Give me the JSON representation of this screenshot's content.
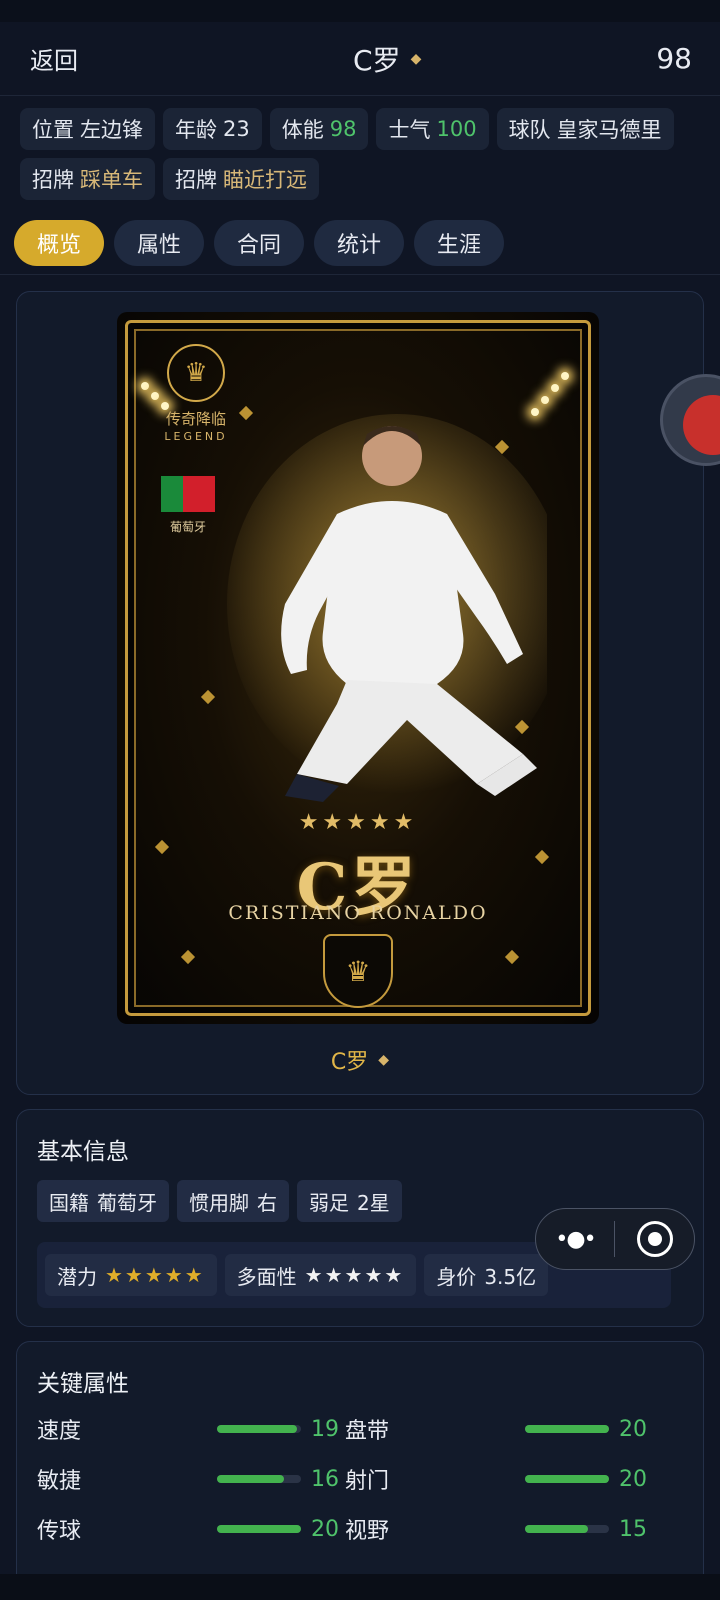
{
  "header": {
    "back_label": "返回",
    "title": "C罗",
    "rating": "98"
  },
  "chips": [
    {
      "label": "位置",
      "value": "左边锋",
      "tone": "plain"
    },
    {
      "label": "年龄",
      "value": "23",
      "tone": "plain"
    },
    {
      "label": "体能",
      "value": "98",
      "tone": "green"
    },
    {
      "label": "士气",
      "value": "100",
      "tone": "green"
    },
    {
      "label": "球队",
      "value": "皇家马德里",
      "tone": "plain"
    },
    {
      "label": "招牌",
      "value": "踩单车",
      "tone": "gold"
    },
    {
      "label": "招牌",
      "value": "瞄近打远",
      "tone": "gold"
    }
  ],
  "tabs": [
    "概览",
    "属性",
    "合同",
    "统计",
    "生涯"
  ],
  "active_tab": "概览",
  "card": {
    "crest_cn": "传奇降临",
    "crest_en": "LEGEND",
    "nation": "葡萄牙",
    "stars": "★★★★★",
    "big_name": "C罗",
    "full_name": "CRISTIANO RONALDO",
    "caption": "C罗"
  },
  "basic_info": {
    "title": "基本信息",
    "nationality": {
      "label": "国籍",
      "value": "葡萄牙"
    },
    "foot": {
      "label": "惯用脚",
      "value": "右"
    },
    "weak_foot": {
      "label": "弱足",
      "value": "2星"
    },
    "potential": {
      "label": "潜力",
      "stars": "★★★★★"
    },
    "versatility": {
      "label": "多面性",
      "stars": "★★★★★"
    },
    "value": {
      "label": "身价",
      "value": "3.5亿"
    }
  },
  "key_attributes": {
    "title": "关键属性",
    "left": [
      {
        "name": "速度",
        "value": "19",
        "fill": 0.95
      },
      {
        "name": "敏捷",
        "value": "16",
        "fill": 0.8
      },
      {
        "name": "传球",
        "value": "20",
        "fill": 1.0
      }
    ],
    "right": [
      {
        "name": "盘带",
        "value": "20",
        "fill": 1.0
      },
      {
        "name": "射门",
        "value": "20",
        "fill": 1.0
      },
      {
        "name": "视野",
        "value": "15",
        "fill": 0.75
      }
    ]
  },
  "capsule": {
    "more_icon": "more-dots-icon",
    "target_icon": "target-icon"
  },
  "colors": {
    "accent": "#d6aa2c",
    "green": "#4fc36b",
    "gold": "#d8b878",
    "bg": "#0f1524"
  }
}
